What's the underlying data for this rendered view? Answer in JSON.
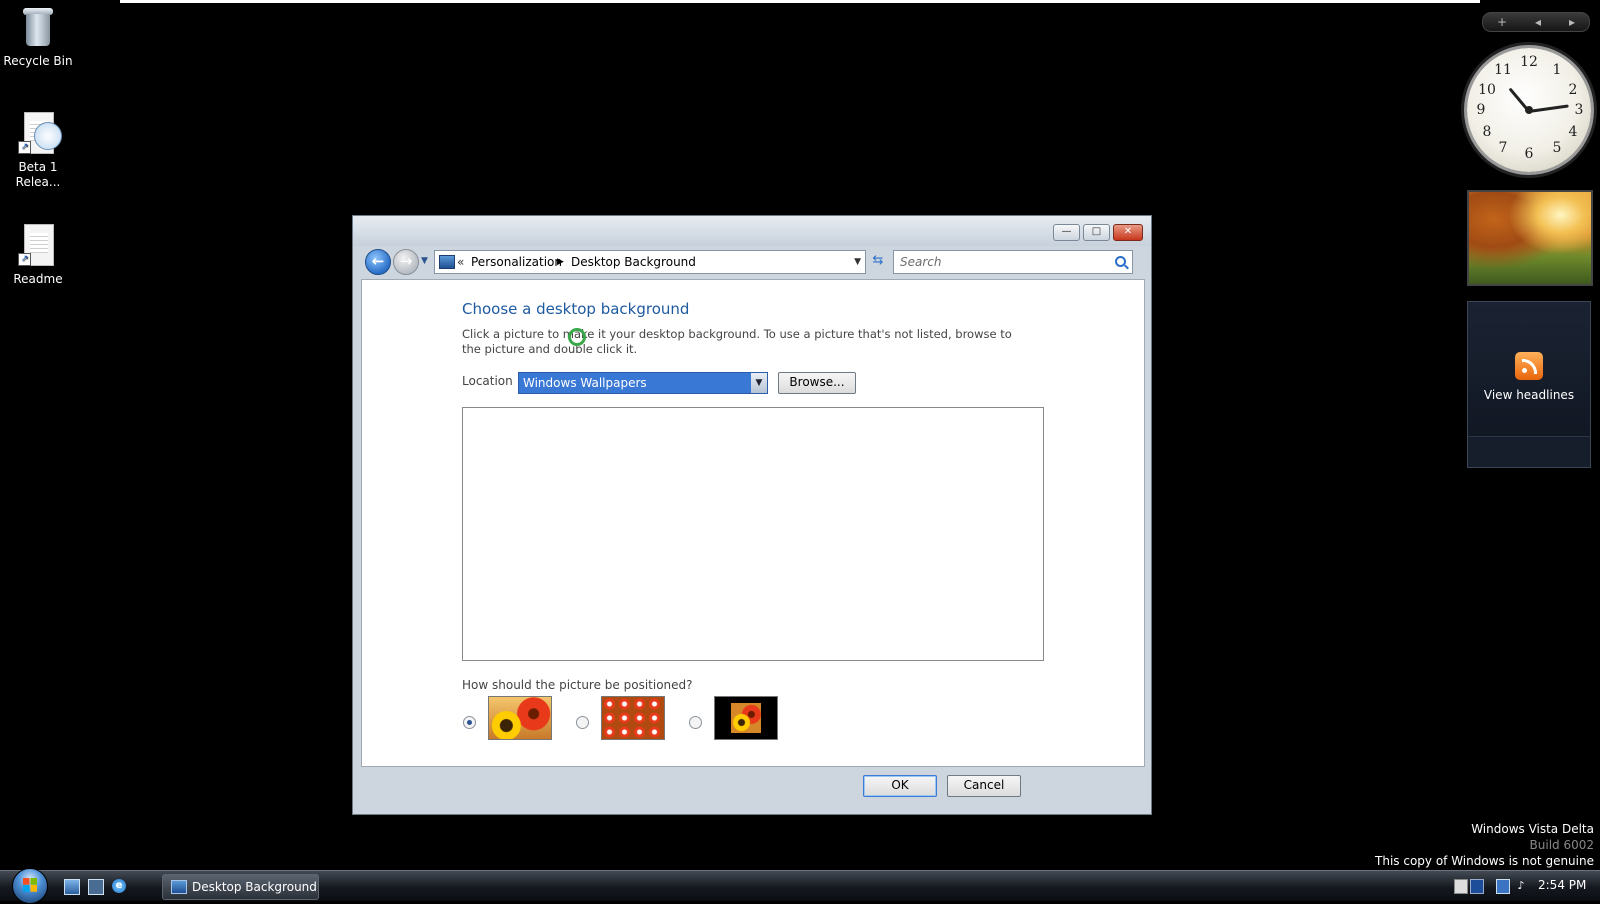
{
  "desktop": {
    "icons": [
      {
        "label": "Recycle Bin"
      },
      {
        "label": "Beta 1 Relea..."
      },
      {
        "label": "Readme"
      }
    ],
    "watermark": {
      "line1": "Windows Vista Delta",
      "line2": "Build 6002",
      "line3": "This copy of Windows is not genuine"
    }
  },
  "gadgets": {
    "toolbar": {
      "add": "+",
      "prev": "◂",
      "next": "▸"
    },
    "clock": {
      "numbers": [
        "12",
        "1",
        "2",
        "3",
        "4",
        "5",
        "6",
        "7",
        "8",
        "9",
        "10",
        "11"
      ]
    },
    "feed": {
      "label": "View headlines"
    }
  },
  "window": {
    "title_buttons": {
      "minimize": "—",
      "maximize": "□",
      "close": "✕"
    },
    "address": {
      "chevron": "«",
      "crumbs": [
        "Personalization",
        "Desktop Background"
      ],
      "separator": "▶"
    },
    "search": {
      "placeholder": "Search"
    },
    "heading": "Choose a desktop background",
    "description": "Click a picture to make it your desktop background. To use a picture that's not listed, browse to the picture and double click it.",
    "location": {
      "label": "Location",
      "selected": "Windows Wallpapers",
      "browse_label": "Browse..."
    },
    "position": {
      "question": "How should the picture be positioned?",
      "options": [
        {
          "name": "fill",
          "selected": true
        },
        {
          "name": "tile",
          "selected": false
        },
        {
          "name": "center",
          "selected": false
        }
      ]
    },
    "buttons": {
      "ok": "OK",
      "cancel": "Cancel"
    }
  },
  "taskbar": {
    "task_label": "Desktop Background",
    "clock": "2:54 PM",
    "ie_glyph": "e"
  },
  "colors": {
    "accent_heading": "#1e5aa0",
    "selection_blue": "#3a78d6",
    "desktop_bg": "#000000"
  }
}
